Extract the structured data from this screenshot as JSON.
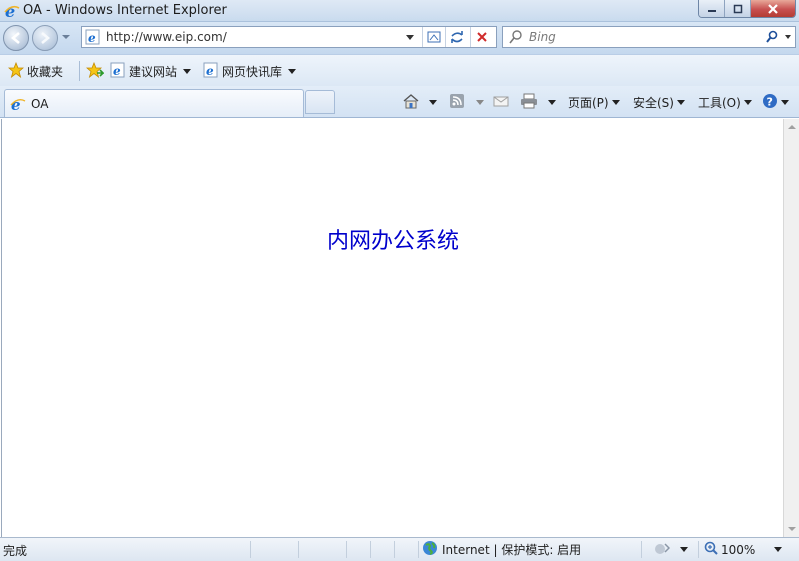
{
  "window": {
    "title": "OA - Windows Internet Explorer"
  },
  "address": {
    "url": "http://www.eip.com/",
    "search_placeholder": "Bing"
  },
  "favorites_bar": {
    "favorites_label": "收藏夹",
    "items": [
      {
        "label": "建议网站",
        "icon": "ie-page-icon"
      },
      {
        "label": "网页快讯库",
        "icon": "ie-page-icon"
      }
    ]
  },
  "tabs": [
    {
      "label": "OA",
      "icon": "ie-page-icon"
    }
  ],
  "command_bar": {
    "page_label": "页面(P)",
    "safety_label": "安全(S)",
    "tools_label": "工具(O)"
  },
  "content": {
    "heading": "内网办公系统"
  },
  "status_bar": {
    "status_text": "完成",
    "zone_label": "Internet | 保护模式: 启用",
    "zoom_label": "100%"
  },
  "colors": {
    "heading": "#0000cc"
  }
}
